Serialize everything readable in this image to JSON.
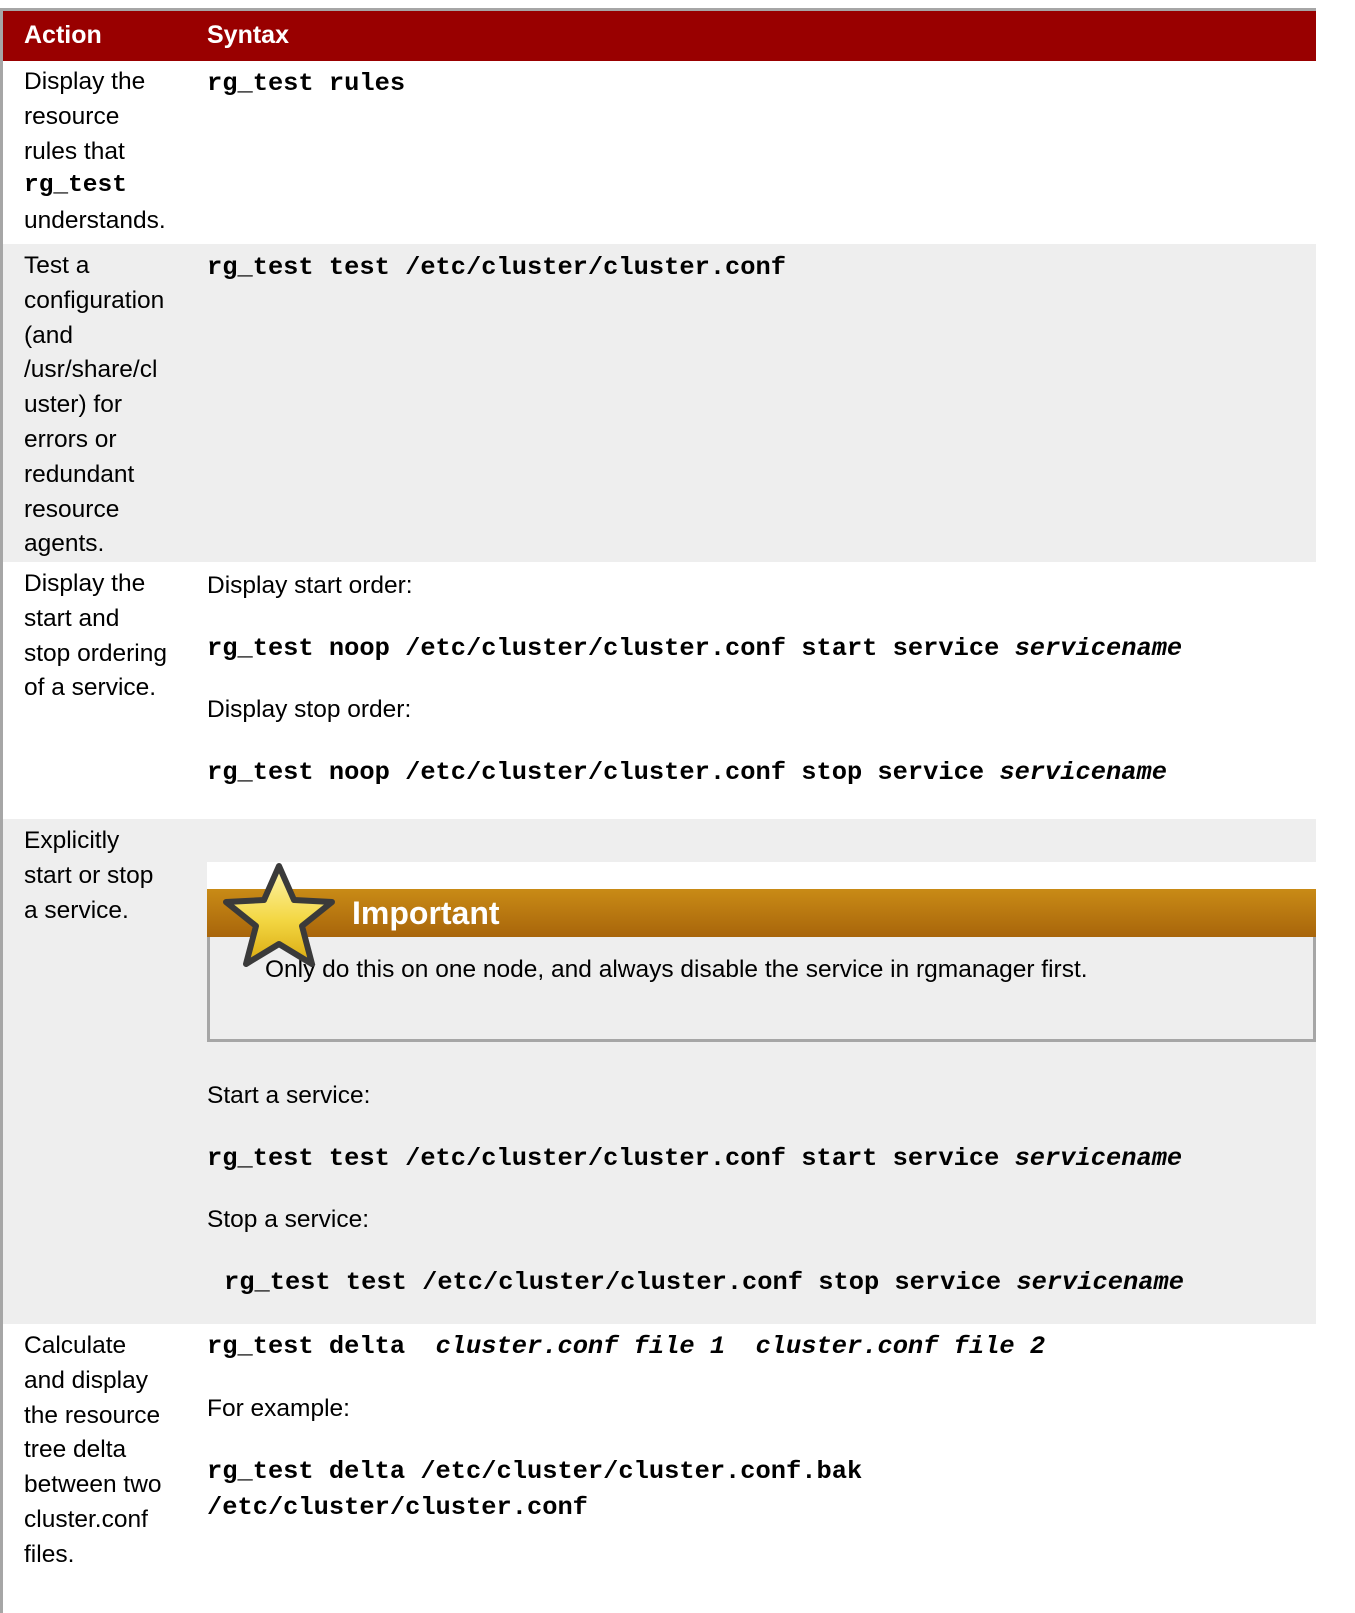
{
  "table": {
    "headers": {
      "action": "Action",
      "syntax": "Syntax"
    },
    "rows": [
      {
        "action_lines": [
          "Display the",
          "resource",
          "rules that"
        ],
        "action_cmd": "rg_test",
        "action_tail": "understands.",
        "syntax_code": "rg_test rules"
      },
      {
        "action_lines": [
          "Test a",
          "configuration",
          "(and",
          "/usr/share/cl",
          "uster) for",
          "errors or",
          "redundant",
          "resource",
          "agents."
        ],
        "syntax_code": "rg_test test /etc/cluster/cluster.conf"
      },
      {
        "action_lines": [
          "Display the",
          "start and",
          "stop ordering",
          "of a service."
        ],
        "start_label": "Display start order:",
        "start_code": "rg_test noop /etc/cluster/cluster.conf start service ",
        "start_code_arg": "servicename",
        "stop_label": "Display stop order:",
        "stop_code": "rg_test noop /etc/cluster/cluster.conf stop service ",
        "stop_code_arg": "servicename"
      },
      {
        "action_lines": [
          "Explicitly",
          "start or stop",
          "a service."
        ],
        "important_title": "Important",
        "important_text": "Only do this on one node, and always disable the service in rgmanager first.",
        "start_label": "Start a service:",
        "start_code": "rg_test test /etc/cluster/cluster.conf start service ",
        "start_code_arg": "servicename",
        "stop_label": "Stop a service:",
        "stop_code": "rg_test test /etc/cluster/cluster.conf stop service ",
        "stop_code_arg": "servicename"
      },
      {
        "action_lines": [
          "Calculate",
          "and display",
          "the resource",
          "tree delta",
          "between two",
          "cluster.conf",
          "files."
        ],
        "delta_code": "rg_test delta  ",
        "delta_arg1": "cluster.conf file 1",
        "delta_sep": "  ",
        "delta_arg2": "cluster.conf file 2",
        "example_label": "For example:",
        "example_line1": "rg_test delta /etc/cluster/cluster.conf.bak",
        "example_line2": "/etc/cluster/cluster.conf"
      }
    ]
  },
  "icons": {
    "important": "star-icon"
  },
  "colors": {
    "header_bg": "#990000",
    "important_bar": "#b87510",
    "alt_row": "#eeeeee"
  }
}
